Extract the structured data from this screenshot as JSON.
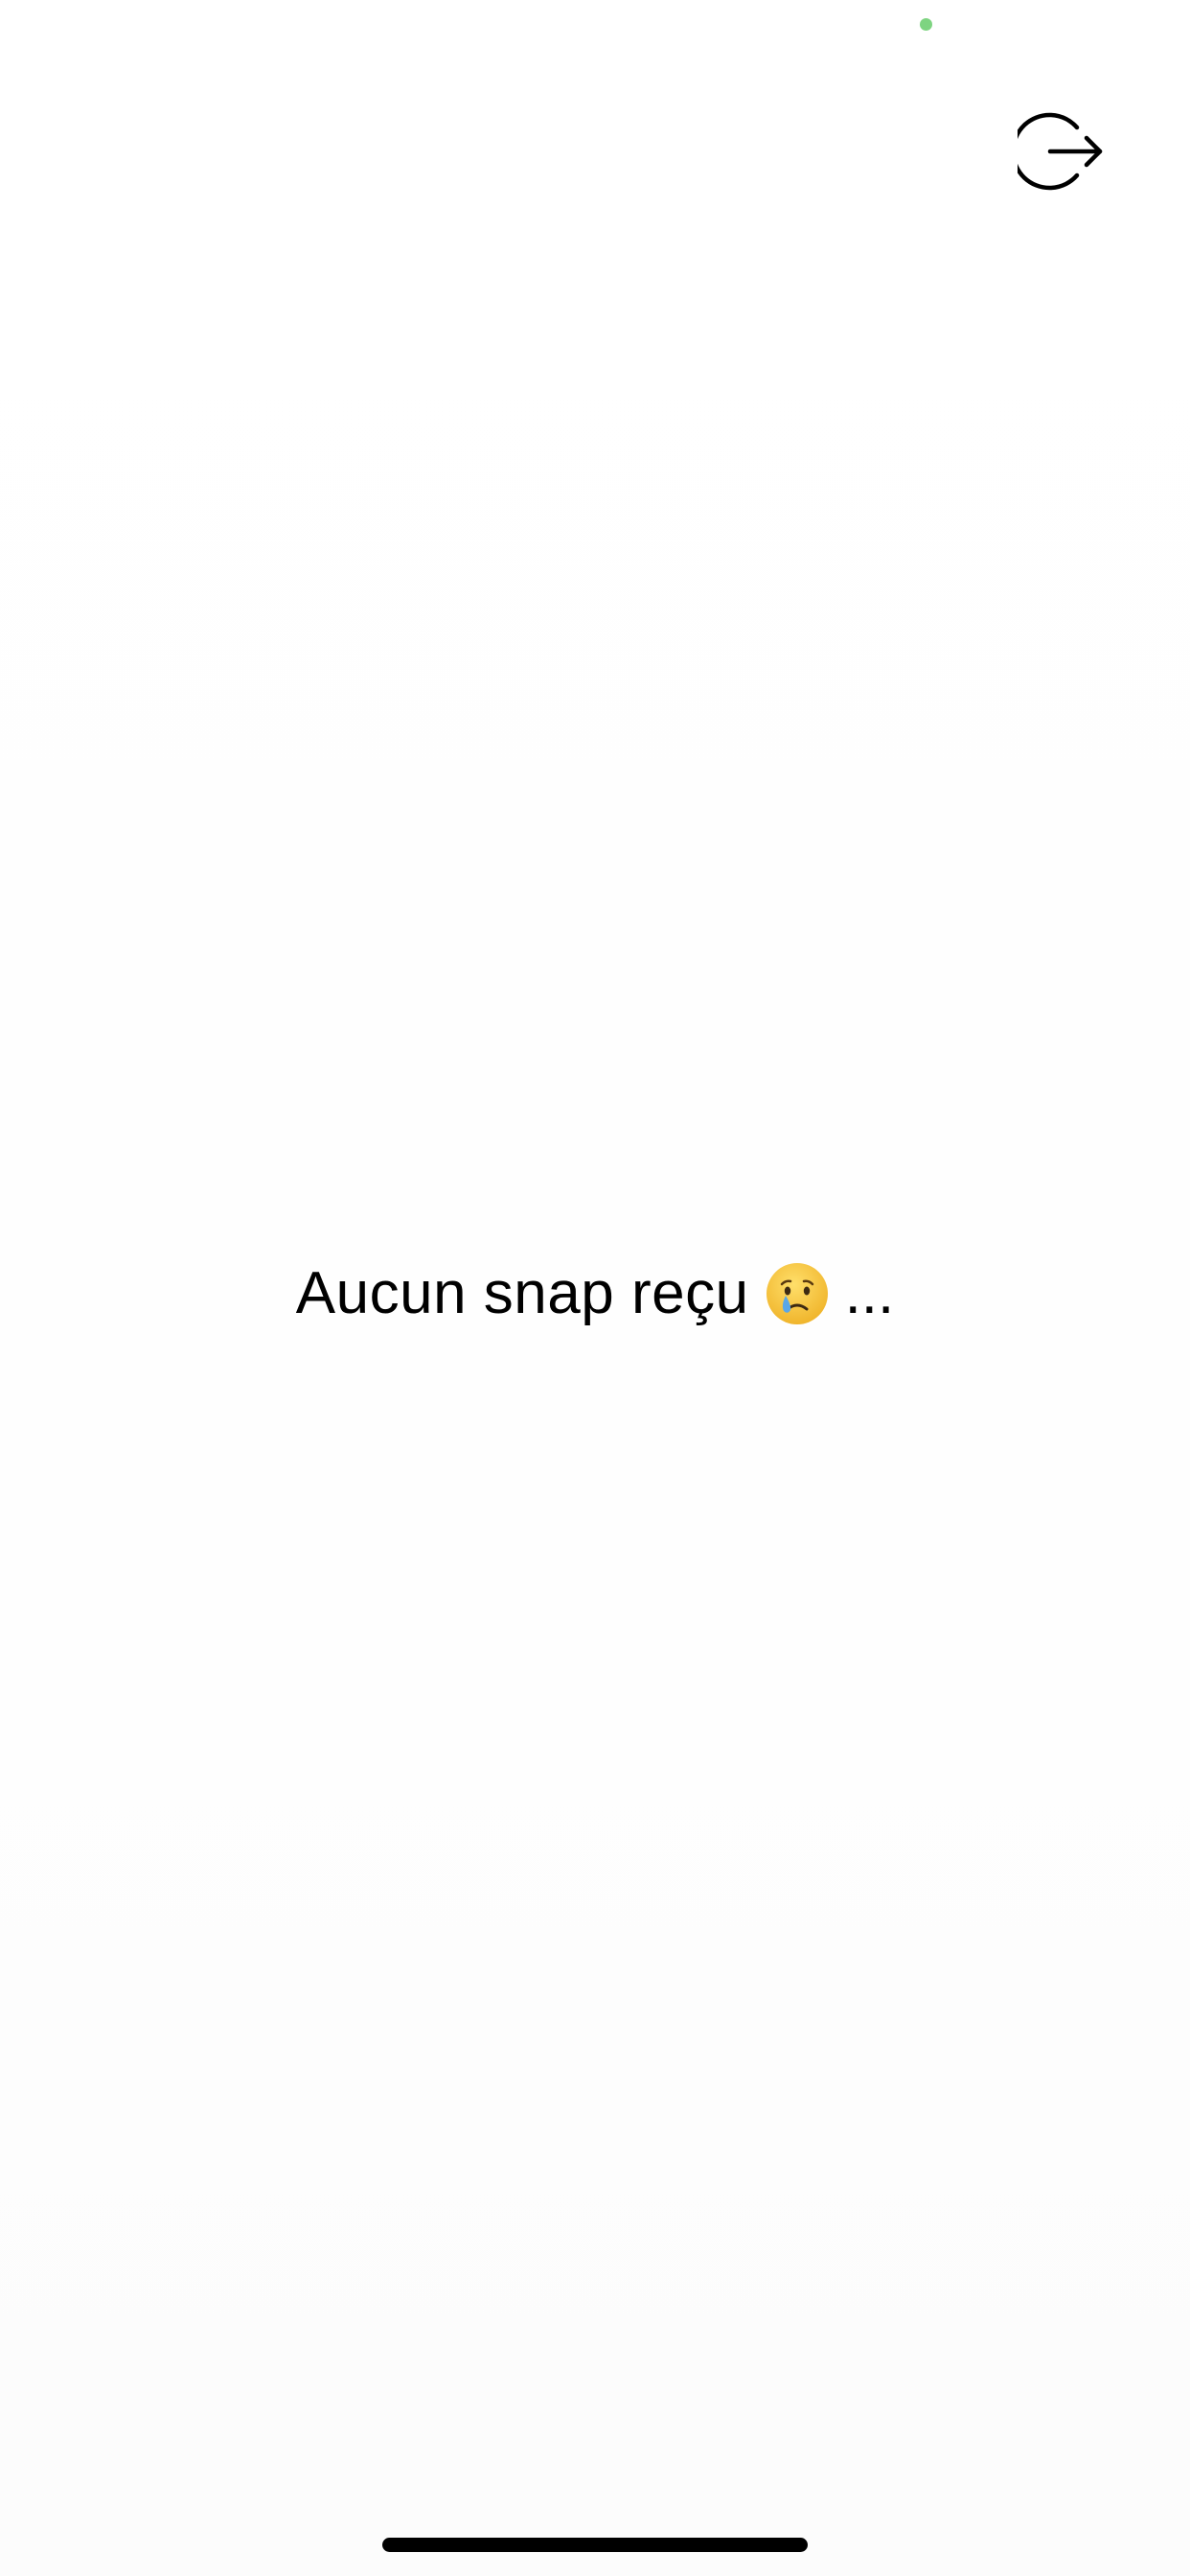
{
  "status_bar": {
    "camera_indicator_color": "#7ed481"
  },
  "header": {
    "logout_icon": "logout-icon"
  },
  "main": {
    "empty_message": "Aucun snap reçu",
    "emoji": "crying-face-emoji",
    "ellipsis": "..."
  },
  "colors": {
    "background": "#ffffff",
    "text": "#000000",
    "emoji_face": "#f7c23a",
    "emoji_tear": "#5aa7e6"
  }
}
